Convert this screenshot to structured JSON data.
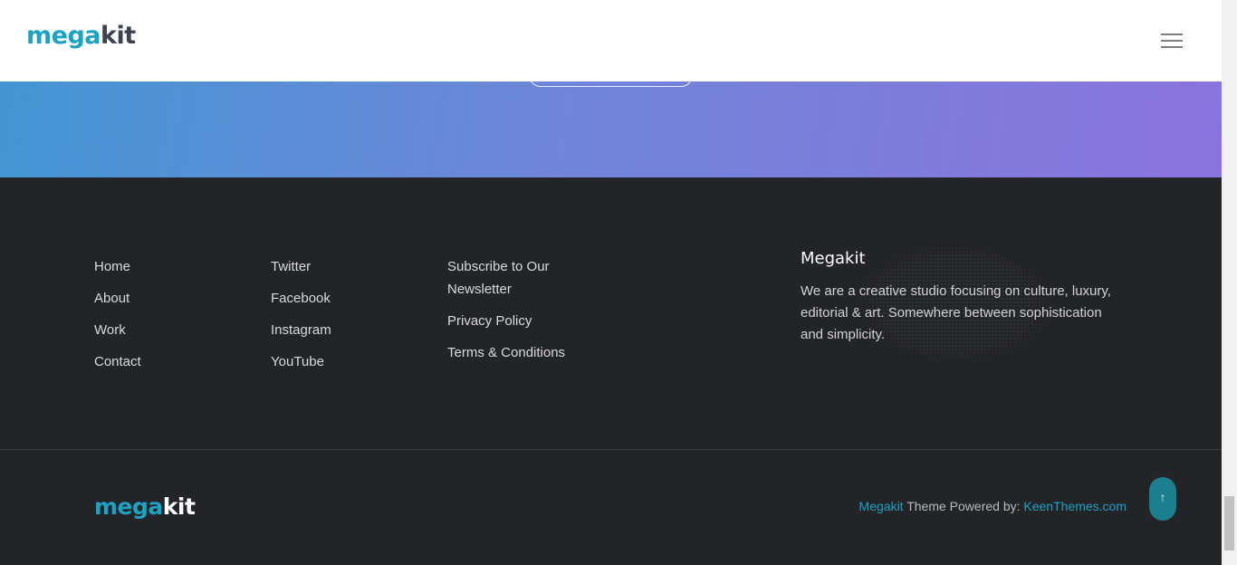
{
  "header": {
    "logo": {
      "mega": "mega",
      "kit": "kit"
    },
    "menu_icon": "hamburger-menu-icon"
  },
  "footer": {
    "nav_columns": [
      [
        "Home",
        "About",
        "Work",
        "Contact"
      ],
      [
        "Twitter",
        "Facebook",
        "Instagram",
        "YouTube"
      ],
      [
        "Subscribe to Our Newsletter",
        "Privacy Policy",
        "Terms & Conditions"
      ]
    ],
    "about": {
      "title": "Megakit",
      "text": "We are a creative studio focusing on culture, luxury, editorial & art. Somewhere between sophistication and simplicity."
    },
    "bottom": {
      "logo": {
        "mega": "mega",
        "kit": "kit"
      },
      "credit_brand": "Megakit",
      "credit_middle": " Theme Powered by: ",
      "credit_link": "KeenThemes.com"
    },
    "to_top_icon": "arrow-up-icon"
  },
  "colors": {
    "accent": "#1ba3c4",
    "footer_bg": "#232427",
    "gradient_start": "#4396d3",
    "gradient_end": "#8b73de"
  }
}
